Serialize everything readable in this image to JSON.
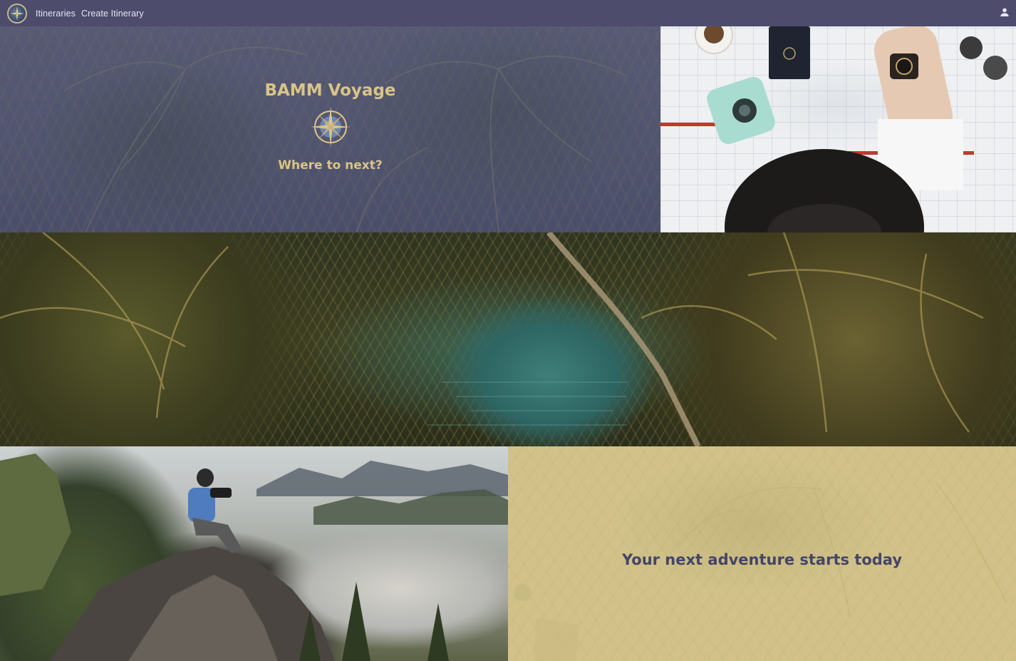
{
  "nav": {
    "links": [
      "Itineraries",
      "Create Itinerary"
    ]
  },
  "hero": {
    "title": "BAMM Voyage",
    "subtitle": "Where to next?"
  },
  "adventure": {
    "tagline": "Your next adventure starts today"
  },
  "icons": {
    "logo": "compass-logo-icon",
    "user": "user-icon",
    "compass": "compass-icon"
  },
  "colors": {
    "navbar": "#4d4c6d",
    "gold": "#d9c488",
    "tagline": "#454567",
    "adventure_bg": "#c9bb84"
  }
}
